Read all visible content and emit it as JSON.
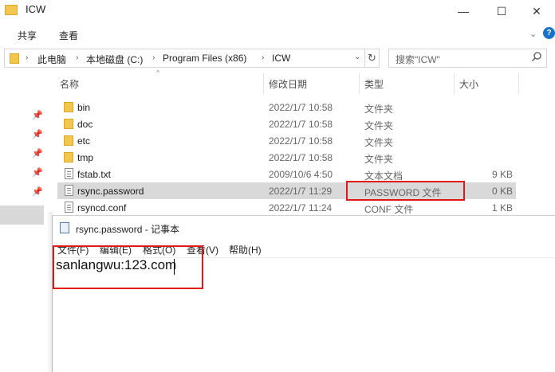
{
  "explorer": {
    "title": "ICW",
    "window_controls": {
      "minimize": "—",
      "maximize": "☐",
      "close": "✕"
    },
    "ribbon_tabs": [
      "共享",
      "查看"
    ],
    "breadcrumb": [
      "此电脑",
      "本地磁盘 (C:)",
      "Program Files (x86)",
      "ICW"
    ],
    "search_placeholder": "搜索\"ICW\"",
    "columns": {
      "name": "名称",
      "modified": "修改日期",
      "type": "类型",
      "size": "大小"
    },
    "files": [
      {
        "name": "bin",
        "modified": "2022/1/7 10:58",
        "type": "文件夹",
        "size": "",
        "icon": "folder-icon"
      },
      {
        "name": "doc",
        "modified": "2022/1/7 10:58",
        "type": "文件夹",
        "size": "",
        "icon": "folder-icon"
      },
      {
        "name": "etc",
        "modified": "2022/1/7 10:58",
        "type": "文件夹",
        "size": "",
        "icon": "folder-icon"
      },
      {
        "name": "tmp",
        "modified": "2022/1/7 10:58",
        "type": "文件夹",
        "size": "",
        "icon": "folder-icon"
      },
      {
        "name": "fstab.txt",
        "modified": "2009/10/6 4:50",
        "type": "文本文档",
        "size": "9 KB",
        "icon": "text-file-icon"
      },
      {
        "name": "rsync.password",
        "modified": "2022/1/7 11:29",
        "type": "PASSWORD 文件",
        "size": "0 KB",
        "icon": "file-icon",
        "selected": true
      },
      {
        "name": "rsyncd.conf",
        "modified": "2022/1/7 11:24",
        "type": "CONF 文件",
        "size": "1 KB",
        "icon": "file-icon"
      }
    ]
  },
  "notepad": {
    "title": "rsync.password - 记事本",
    "menu": [
      "文件(F)",
      "编辑(E)",
      "格式(O)",
      "查看(V)",
      "帮助(H)"
    ],
    "content": "sanlangwu:123.com"
  },
  "colors": {
    "highlight": "#e01818",
    "selection": "#d9d9d9",
    "folder": "#f3c74f"
  }
}
